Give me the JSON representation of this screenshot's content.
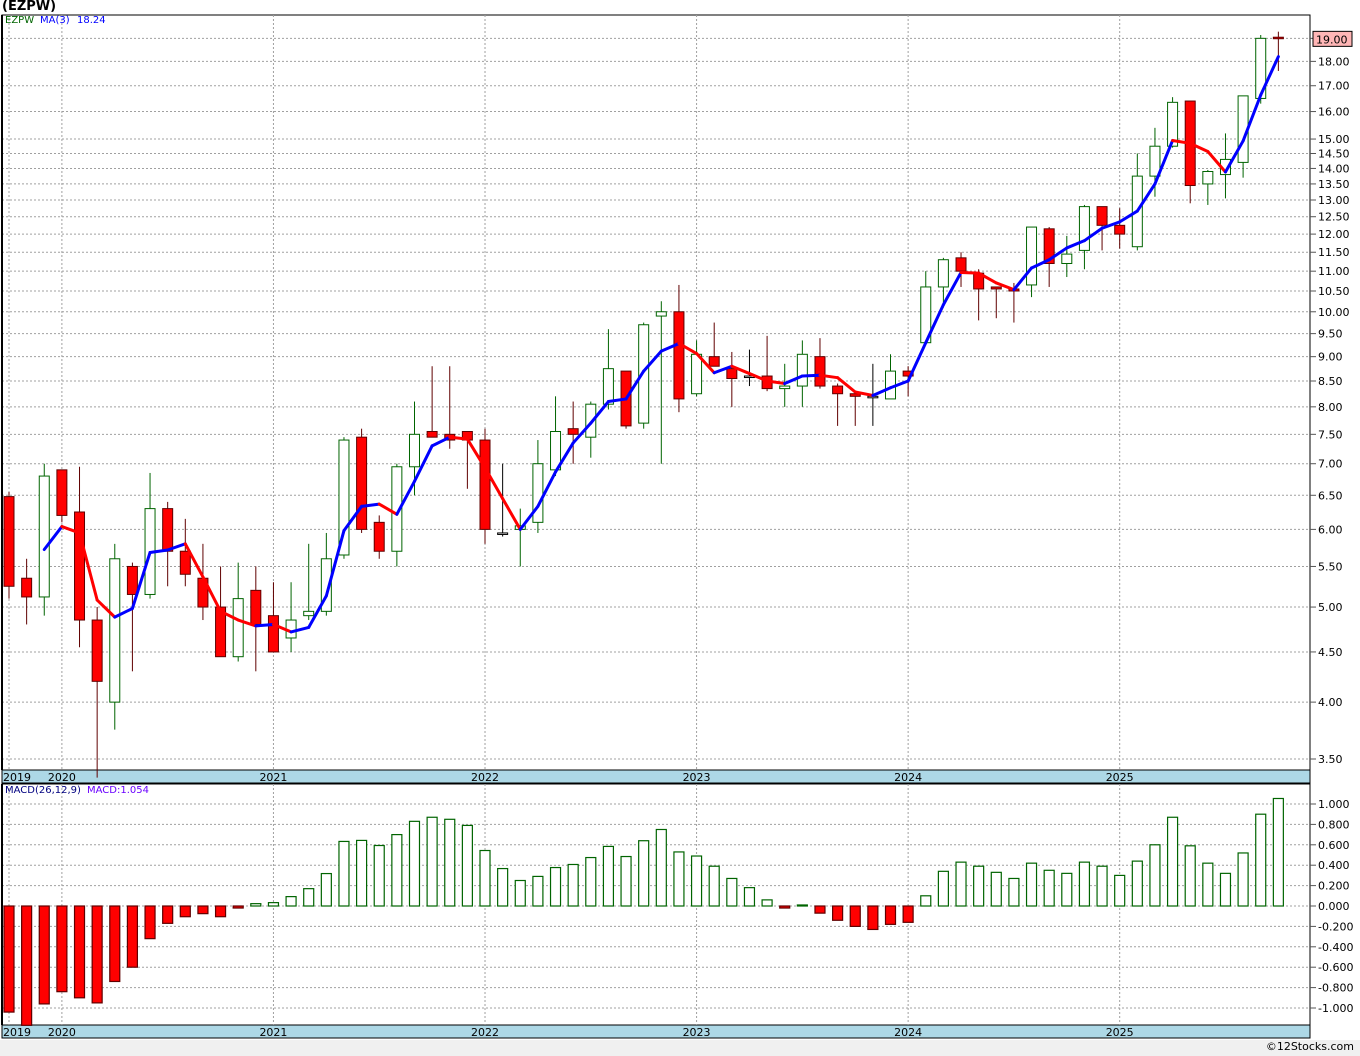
{
  "title": "(EZPW)",
  "price_legend": {
    "symbol": "EZPW",
    "ma_label": "MA(3)",
    "ma_value": "18.24"
  },
  "macd_legend": {
    "label": "MACD(26,12,9)",
    "value_label": "MACD:1.054"
  },
  "last_price_label": "19.00",
  "credit": "©12Stocks.com",
  "colors": {
    "up": "#006400",
    "down": "#ff0000",
    "ma_up": "#0000ff",
    "ma_down": "#ff0000",
    "date_band": "#add8e6",
    "last_price_box": "#ffb6b6"
  },
  "chart_data": [
    {
      "type": "candlestick",
      "title": "(EZPW)",
      "scale": "log",
      "ylim": [
        3.35,
        19.4
      ],
      "grid": true,
      "y_ticks": [
        "3.50",
        "4.00",
        "4.50",
        "5.00",
        "5.50",
        "6.00",
        "6.50",
        "7.00",
        "7.50",
        "8.00",
        "8.50",
        "9.00",
        "9.50",
        "10.00",
        "10.50",
        "11.00",
        "11.50",
        "12.00",
        "12.50",
        "13.00",
        "13.50",
        "14.00",
        "14.50",
        "15.00",
        "16.00",
        "17.00",
        "18.00",
        "19.00"
      ],
      "x_year_labels": [
        {
          "label": "2019",
          "month": "2019-10"
        },
        {
          "label": "2020",
          "month": "2020-01"
        },
        {
          "label": "2021",
          "month": "2021-01"
        },
        {
          "label": "2022",
          "month": "2022-01"
        },
        {
          "label": "2023",
          "month": "2023-01"
        },
        {
          "label": "2024",
          "month": "2024-01"
        },
        {
          "label": "2025",
          "month": "2025-01"
        }
      ],
      "start_month": "2019-10",
      "interval": "monthly",
      "open": [
        6.48,
        5.35,
        5.12,
        6.9,
        6.25,
        4.85,
        4.0,
        5.5,
        5.15,
        6.3,
        5.7,
        5.35,
        5.0,
        4.45,
        5.2,
        4.9,
        4.65,
        4.9,
        4.95,
        5.65,
        7.45,
        6.1,
        5.7,
        6.95,
        7.55,
        7.5,
        7.55,
        7.4,
        5.95,
        6.0,
        6.1,
        6.9,
        7.6,
        7.45,
        8.05,
        8.7,
        7.7,
        9.9,
        10.0,
        8.25,
        9.0,
        8.75,
        8.6,
        8.6,
        8.35,
        8.4,
        9.0,
        8.4,
        8.25,
        8.2,
        8.15,
        8.7,
        9.3,
        10.6,
        11.35,
        10.95,
        10.6,
        10.55,
        10.65,
        12.15,
        11.2,
        11.55,
        12.8,
        12.25,
        11.65,
        13.75,
        14.75,
        16.4,
        13.5,
        13.8,
        14.2,
        16.5,
        19.05
      ],
      "high": [
        6.55,
        5.6,
        7.0,
        6.9,
        6.95,
        5.0,
        5.8,
        5.55,
        6.85,
        6.4,
        6.15,
        5.8,
        5.5,
        5.55,
        5.5,
        5.3,
        5.3,
        5.8,
        5.95,
        7.45,
        7.6,
        6.2,
        7.0,
        8.1,
        8.8,
        8.8,
        7.55,
        7.6,
        7.0,
        6.3,
        7.4,
        8.2,
        8.1,
        8.1,
        9.6,
        8.7,
        9.75,
        10.25,
        10.65,
        9.35,
        9.75,
        9.1,
        9.15,
        9.45,
        8.85,
        9.35,
        9.4,
        8.45,
        8.25,
        8.85,
        9.05,
        8.8,
        11.0,
        11.35,
        11.5,
        11.05,
        10.6,
        10.7,
        12.2,
        12.2,
        11.95,
        12.85,
        12.8,
        12.75,
        14.5,
        15.4,
        16.55,
        16.4,
        13.95,
        15.2,
        16.6,
        19.15,
        19.3
      ],
      "low": [
        5.1,
        4.8,
        4.9,
        6.1,
        4.55,
        3.35,
        3.75,
        4.3,
        5.1,
        5.25,
        5.25,
        4.85,
        4.45,
        4.4,
        4.3,
        4.5,
        4.5,
        4.85,
        4.9,
        5.6,
        5.95,
        5.6,
        5.5,
        6.5,
        7.45,
        7.25,
        6.6,
        5.8,
        5.9,
        5.5,
        5.95,
        6.8,
        7.0,
        7.1,
        7.95,
        7.6,
        7.6,
        7.0,
        7.9,
        8.2,
        8.8,
        8.0,
        8.4,
        8.3,
        8.0,
        8.0,
        8.35,
        7.65,
        7.65,
        7.65,
        8.15,
        8.2,
        9.3,
        10.1,
        10.6,
        9.8,
        9.85,
        9.75,
        10.35,
        10.6,
        10.85,
        11.05,
        11.55,
        11.6,
        11.55,
        13.1,
        14.7,
        12.9,
        12.85,
        13.05,
        13.7,
        16.3,
        17.6
      ],
      "close": [
        5.25,
        5.12,
        6.8,
        6.2,
        4.85,
        4.2,
        5.6,
        5.15,
        6.3,
        5.7,
        5.4,
        5.0,
        4.45,
        5.1,
        4.8,
        4.5,
        4.85,
        4.95,
        5.6,
        7.4,
        6.0,
        5.7,
        6.95,
        7.5,
        7.45,
        7.4,
        7.4,
        6.0,
        5.95,
        6.05,
        7.0,
        7.55,
        7.5,
        8.05,
        8.75,
        7.65,
        9.7,
        10.0,
        8.15,
        9.05,
        8.8,
        8.55,
        8.6,
        8.35,
        8.4,
        9.05,
        8.4,
        8.25,
        8.2,
        8.2,
        8.7,
        8.6,
        10.6,
        11.3,
        11.0,
        10.55,
        10.55,
        10.5,
        12.2,
        11.2,
        11.45,
        12.8,
        12.25,
        12.0,
        13.75,
        14.75,
        16.35,
        13.45,
        13.9,
        14.3,
        16.6,
        19.0,
        19.0
      ],
      "overlay": {
        "type": "line",
        "name": "MA(3)",
        "period": 3
      }
    },
    {
      "type": "bar",
      "title": "MACD(26,12,9)",
      "ylim": [
        -1.18,
        1.1
      ],
      "grid": true,
      "y_ticks": [
        "1.000",
        "0.800",
        "0.600",
        "0.400",
        "0.200",
        "0.000",
        "-0.200",
        "-0.400",
        "-0.600",
        "-0.800",
        "-1.000"
      ],
      "values": [
        -1.04,
        -1.17,
        -0.96,
        -0.84,
        -0.9,
        -0.95,
        -0.74,
        -0.6,
        -0.32,
        -0.17,
        -0.105,
        -0.075,
        -0.105,
        -0.02,
        0.023,
        0.033,
        0.092,
        0.17,
        0.318,
        0.633,
        0.643,
        0.593,
        0.7,
        0.83,
        0.87,
        0.85,
        0.79,
        0.544,
        0.367,
        0.25,
        0.29,
        0.377,
        0.407,
        0.475,
        0.584,
        0.485,
        0.64,
        0.75,
        0.53,
        0.49,
        0.39,
        0.27,
        0.18,
        0.06,
        -0.02,
        0.01,
        -0.07,
        -0.14,
        -0.2,
        -0.23,
        -0.18,
        -0.16,
        0.1,
        0.34,
        0.43,
        0.39,
        0.33,
        0.27,
        0.42,
        0.35,
        0.32,
        0.43,
        0.39,
        0.3,
        0.44,
        0.6,
        0.87,
        0.59,
        0.42,
        0.32,
        0.52,
        0.9,
        1.054
      ]
    }
  ]
}
